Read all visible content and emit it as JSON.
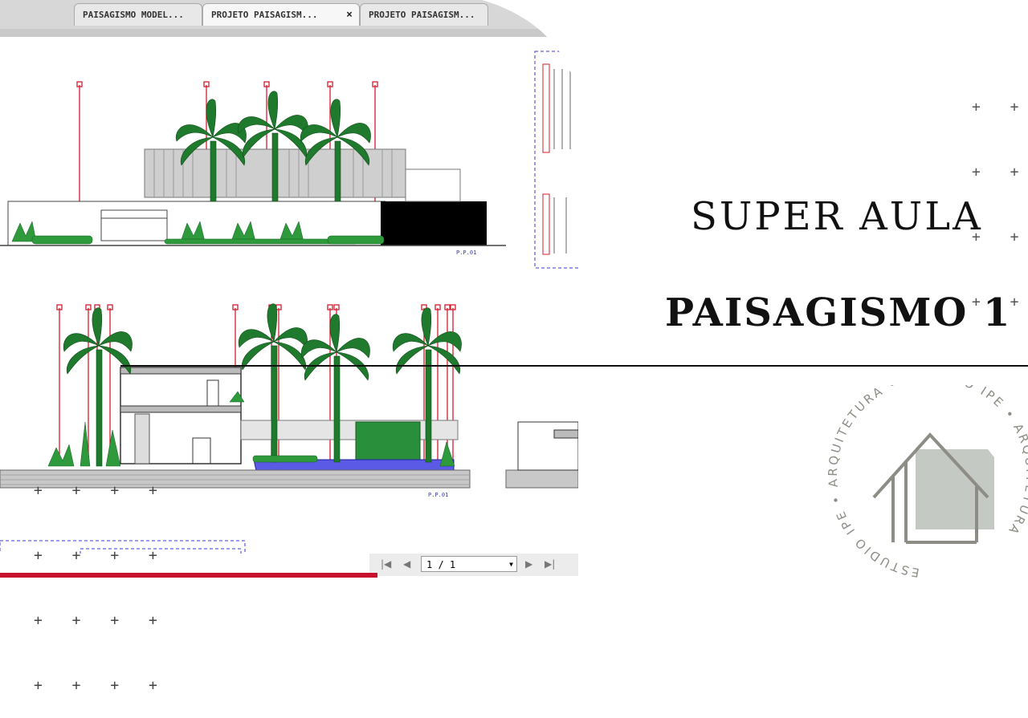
{
  "tabs": [
    {
      "label": "PAISAGISMO MODEL..."
    },
    {
      "label": "PROJETO  PAISAGISM...",
      "active": true,
      "close": "×"
    },
    {
      "label": "PROJETO PAISAGISM..."
    }
  ],
  "drawing": {
    "elevation_label_1": "P.P.01",
    "elevation_label_2": "P.P.01"
  },
  "pager": {
    "first": "|◀",
    "prev": "◀",
    "page_value": "1 / 1",
    "dropdown": "▼",
    "next": "▶",
    "last": "▶|"
  },
  "title": {
    "line1": "SUPER AULA",
    "line2": "PAISAGISMO 1"
  },
  "decor": {
    "plus_rows_top": [
      "+ + +",
      "+ + +",
      "+ + +",
      "+ + +"
    ],
    "plus_rows_bottom": [
      "+ + + +",
      "+ + + +",
      "+ + + +",
      "+ + + +"
    ]
  },
  "logo": {
    "ring_text": "ESTUDIO IPE • ARQUITETURA • ESTUDIO IPE • ARQUITETURA",
    "accent_color": "#c5c9c3",
    "line_color": "#8d8d85"
  },
  "colors": {
    "plant_green": "#1f7a2e",
    "marker_red": "#d41c2c",
    "water_blue": "#5a5ae6"
  }
}
